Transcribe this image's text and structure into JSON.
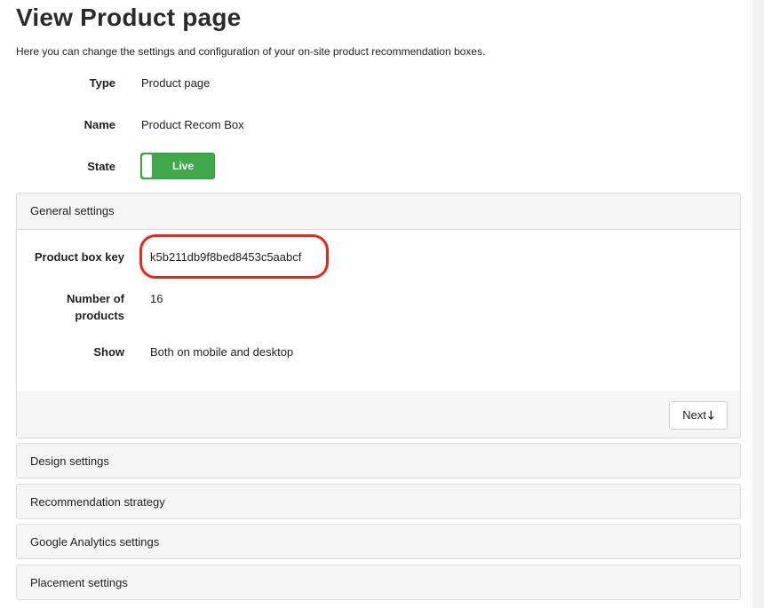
{
  "page": {
    "title": "View Product page",
    "subtitle": "Here you can change the settings and configuration of your on-site product recommendation boxes."
  },
  "info": {
    "type_label": "Type",
    "type_value": "Product page",
    "name_label": "Name",
    "name_value": "Product Recom Box",
    "state_label": "State",
    "state_toggle": "Live"
  },
  "general_settings": {
    "header": "General settings",
    "product_box_key_label": "Product box key",
    "product_box_key_value": "k5b211db9f8bed8453c5aabcf",
    "number_of_products_label_line1": "Number of",
    "number_of_products_label_line2": "products",
    "number_of_products_value": "16",
    "show_label": "Show",
    "show_value": "Both on mobile and desktop",
    "next_label": "Next",
    "next_icon": "arrow-down-icon"
  },
  "sections": [
    {
      "label": "Design settings"
    },
    {
      "label": "Recommendation strategy"
    },
    {
      "label": "Google Analytics settings"
    },
    {
      "label": "Placement settings"
    }
  ],
  "colors": {
    "toggle_on": "#3ea84a",
    "highlight": "#e8271c"
  }
}
